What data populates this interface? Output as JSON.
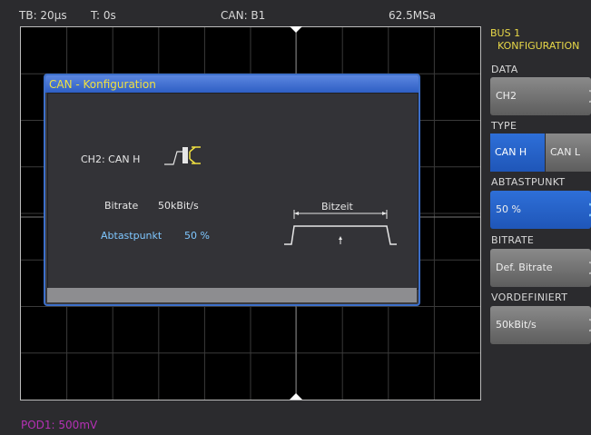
{
  "status": {
    "timebase": "TB: 20µs",
    "trigger_time": "T: 0s",
    "can": "CAN: B1",
    "sample_rate": "62.5MSa"
  },
  "probe": "POD1: 500mV",
  "menu": {
    "title_line1": "BUS 1",
    "title_line2": "KONFIGURATION",
    "data_label": "DATA",
    "data_value": "CH2",
    "type_label": "TYPE",
    "type_options": [
      "CAN H",
      "CAN L"
    ],
    "type_selected": "CAN H",
    "abtastpunkt_label": "ABTASTPUNKT",
    "abtastpunkt_value": "50 %",
    "bitrate_label": "BITRATE",
    "bitrate_button": "Def. Bitrate",
    "vordefiniert_label": "VORDEFINIERT",
    "vordefiniert_value": "50kBit/s"
  },
  "dialog": {
    "title": "CAN - Konfiguration",
    "channel_label": "CH2: CAN H",
    "bitrate_label": "Bitrate",
    "bitrate_value": "50kBit/s",
    "sample_label": "Abtastpunkt",
    "sample_value": "50 %",
    "bitzeit": "Bitzeit"
  },
  "colors": {
    "accent_blue": "#2e6fd8",
    "title_yellow": "#f0e040",
    "probe_magenta": "#b531b5",
    "highlight_cyan": "#7fc7ff"
  }
}
